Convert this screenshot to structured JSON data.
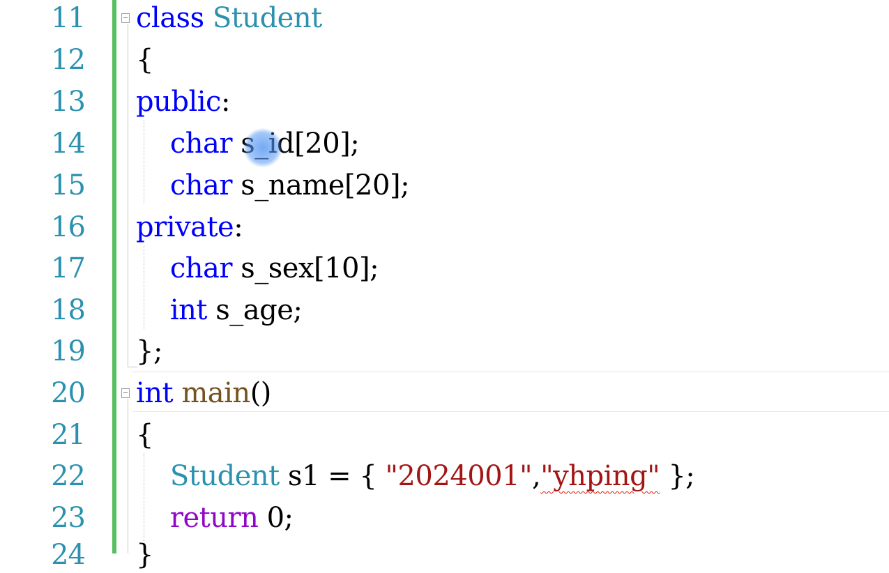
{
  "editor": {
    "line_numbers": [
      "11",
      "12",
      "13",
      "14",
      "15",
      "16",
      "17",
      "18",
      "19",
      "20",
      "21",
      "22",
      "23",
      "24"
    ],
    "lines": {
      "l11": {
        "kw": "class",
        "sp": " ",
        "name": "Student"
      },
      "l12": {
        "brace": "{"
      },
      "l13": {
        "kw": "public",
        "punct": ":"
      },
      "l14": {
        "indent": "    ",
        "kw": "char",
        "rest": " s_id[20];"
      },
      "l15": {
        "indent": "    ",
        "kw": "char",
        "rest": " s_name[20];"
      },
      "l16": {
        "kw": "private",
        "punct": ":"
      },
      "l17": {
        "indent": "    ",
        "kw": "char",
        "rest": " s_sex[10];"
      },
      "l18": {
        "indent": "    ",
        "kw": "int",
        "rest": " s_age;"
      },
      "l19": {
        "text": "};"
      },
      "l20": {
        "kw": "int",
        "sp": " ",
        "fn": "main",
        "rest": "()"
      },
      "l21": {
        "brace": "{"
      },
      "l22": {
        "indent": "    ",
        "type": "Student",
        "mid": " s1 = { ",
        "str1": "\"2024001\"",
        "comma": ",",
        "str2": "\"yhping\"",
        "end": " };"
      },
      "l23": {
        "indent": "    ",
        "kw": "return",
        "rest": " 0;"
      },
      "l24": {
        "text": "}"
      }
    }
  },
  "colors": {
    "keyword": "#0000ff",
    "type": "#2b91af",
    "string": "#a31515",
    "control": "#8f08c4",
    "change_bar": "#58c061"
  },
  "icons": {
    "fold": "collapse-toggle-icon",
    "cursor": "mouse-cursor-icon"
  }
}
